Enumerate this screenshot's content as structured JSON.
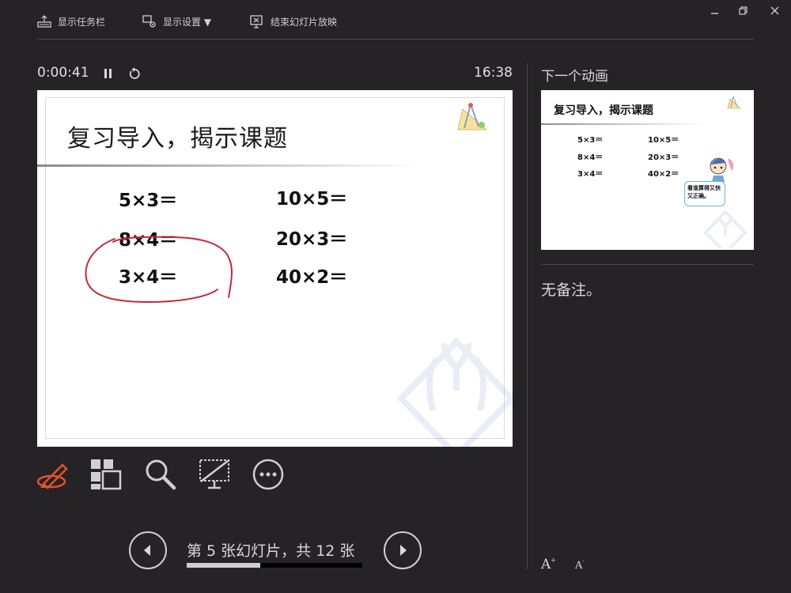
{
  "toolbar": {
    "show_taskbar": "显示任务栏",
    "display_settings": "显示设置 ▼",
    "end_show": "结束幻灯片放映"
  },
  "presenter": {
    "elapsed_time": "0:00:41",
    "clock": "16:38"
  },
  "slide": {
    "title": "复习导入，揭示课题",
    "equations_left": [
      "5×3＝",
      "8×4＝",
      "3×4＝"
    ],
    "equations_right": [
      "10×5＝",
      "20×3＝",
      "40×2＝"
    ]
  },
  "next_preview": {
    "label": "下一个动画",
    "title": "复习导入，揭示课题",
    "equations_left": [
      "5×3＝",
      "8×4＝",
      "3×4＝"
    ],
    "equations_right": [
      "10×5＝",
      "20×3＝",
      "40×2＝"
    ],
    "bubble_text": "看谁算得又快又正确。"
  },
  "notes": {
    "text": "无备注。"
  },
  "navigation": {
    "counter": "第 5 张幻灯片，共 12 张",
    "progress": 0.4167
  },
  "font_controls": {
    "increase": "A",
    "decrease": "A"
  },
  "colors": {
    "background": "#262326",
    "pen_active": "#e0532c",
    "ink": "#c8283c"
  }
}
